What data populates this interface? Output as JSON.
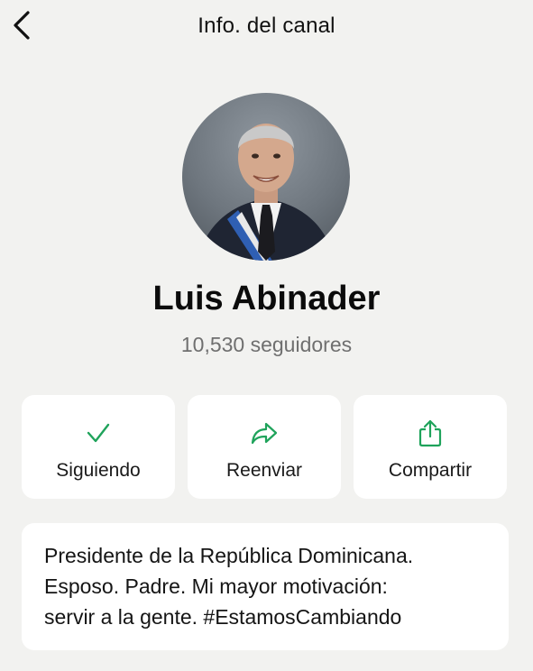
{
  "header": {
    "back_icon": "chevron-left-icon",
    "title": "Info. del canal"
  },
  "channel": {
    "name": "Luis Abinader",
    "followers": "10,530 seguidores"
  },
  "actions": [
    {
      "label": "Siguiendo",
      "icon": "checkmark-icon"
    },
    {
      "label": "Reenviar",
      "icon": "forward-arrow-icon"
    },
    {
      "label": "Compartir",
      "icon": "share-icon"
    }
  ],
  "description": {
    "line1": "Presidente de la República Dominicana.",
    "line2": "Esposo. Padre. Mi mayor motivación:",
    "line3": "servir a la gente. #EstamosCambiando"
  },
  "colors": {
    "background": "#f2f2f0",
    "card": "#ffffff",
    "accent_green": "#1fa35b",
    "secondary_text": "#6f6f6f"
  }
}
